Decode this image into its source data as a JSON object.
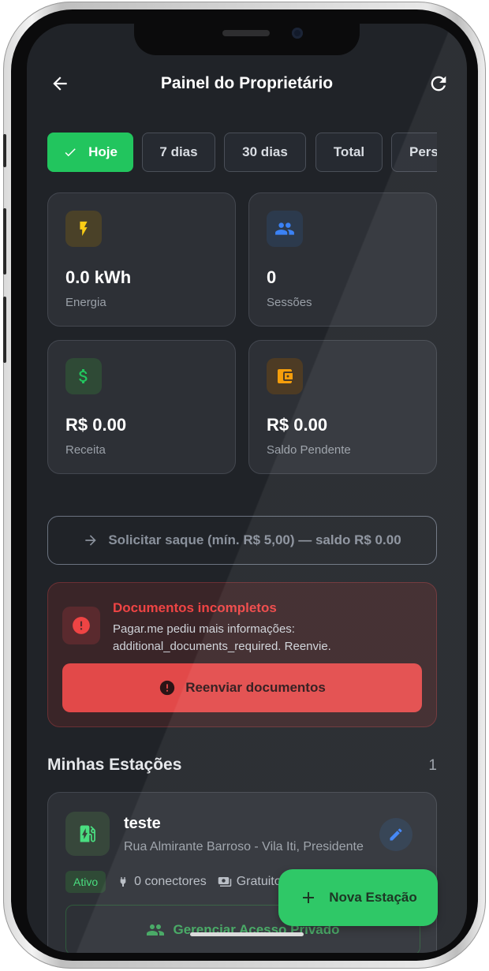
{
  "header": {
    "title": "Painel do Proprietário"
  },
  "periods": [
    {
      "label": "Hoje",
      "active": true
    },
    {
      "label": "7 dias",
      "active": false
    },
    {
      "label": "30 dias",
      "active": false
    },
    {
      "label": "Total",
      "active": false
    },
    {
      "label": "Pers",
      "active": false
    }
  ],
  "stats": [
    {
      "value": "0.0 kWh",
      "label": "Energia",
      "icon": "bolt-icon",
      "color": "#facc15"
    },
    {
      "value": "0",
      "label": "Sessões",
      "icon": "users-icon",
      "color": "#3b82f6"
    },
    {
      "value": "R$ 0.00",
      "label": "Receita",
      "icon": "dollar-icon",
      "color": "#22c55e"
    },
    {
      "value": "R$ 0.00",
      "label": "Saldo Pendente",
      "icon": "wallet-icon",
      "color": "#f59e0b"
    }
  ],
  "withdraw": {
    "label": "Solicitar saque (mín. R$ 5,00) — saldo R$ 0.00"
  },
  "alert": {
    "title": "Documentos incompletos",
    "message": "Pagar.me pediu mais informações: additional_documents_required. Reenvie.",
    "button": "Reenviar documentos"
  },
  "stations_section": {
    "title": "Minhas Estações",
    "count": "1"
  },
  "station": {
    "name": "teste",
    "address": "Rua Almirante Barroso - Vila Iti, Presidente",
    "status": "Ativo",
    "connectors": "0 conectores",
    "pricing": "Gratuito",
    "manage_label": "Gerenciar Acesso Privado"
  },
  "fab": {
    "label": "Nova Estação"
  },
  "colors": {
    "accent": "#22c55e",
    "danger": "#ef4444",
    "background": "#202328"
  }
}
